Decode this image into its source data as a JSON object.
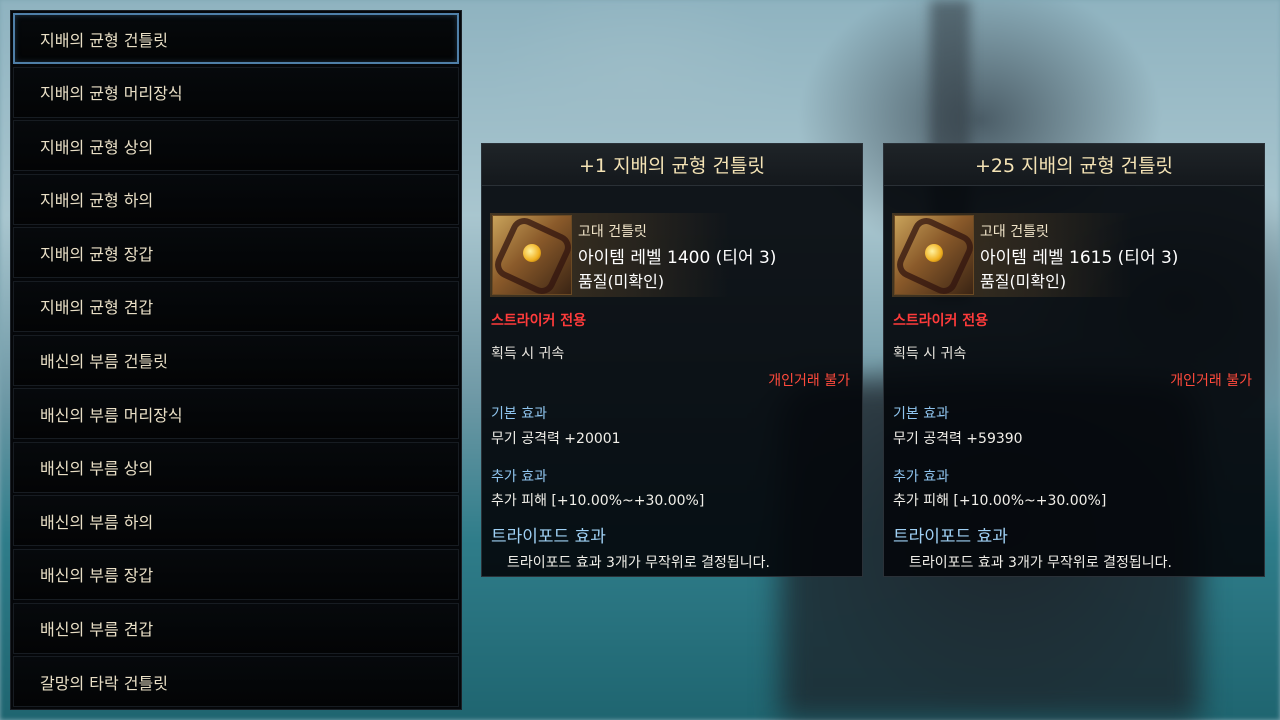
{
  "item_list": [
    "지배의 균형 건틀릿",
    "지배의 균형 머리장식",
    "지배의 균형 상의",
    "지배의 균형 하의",
    "지배의 균형 장갑",
    "지배의 균형 견갑",
    "배신의 부름 건틀릿",
    "배신의 부름 머리장식",
    "배신의 부름 상의",
    "배신의 부름 하의",
    "배신의 부름 장갑",
    "배신의 부름 견갑",
    "갈망의 타락 건틀릿"
  ],
  "selected_index": 0,
  "tooltips": [
    {
      "title": "+1 지배의 균형 건틀릿",
      "grade": "고대 건틀릿",
      "item_level": "아이템 레벨 1400 (티어 3)",
      "quality": "품질(미확인)",
      "class_restriction": "스트라이커 전용",
      "bind": "획득 시 귀속",
      "trade": "개인거래 불가",
      "base_effect_label": "기본 효과",
      "base_effect_value": "무기 공격력 +20001",
      "extra_effect_label": "추가 효과",
      "extra_effect_value": "추가 피해 [+10.00%~+30.00%]",
      "tripod_label": "트라이포드 효과",
      "tripod_desc": "트라이포드 효과 3개가 무작위로 결정됩니다."
    },
    {
      "title": "+25 지배의 균형 건틀릿",
      "grade": "고대 건틀릿",
      "item_level": "아이템 레벨 1615 (티어 3)",
      "quality": "품질(미확인)",
      "class_restriction": "스트라이커 전용",
      "bind": "획득 시 귀속",
      "trade": "개인거래 불가",
      "base_effect_label": "기본 효과",
      "base_effect_value": "무기 공격력 +59390",
      "extra_effect_label": "추가 효과",
      "extra_effect_value": "추가 피해 [+10.00%~+30.00%]",
      "tripod_label": "트라이포드 효과",
      "tripod_desc": "트라이포드 효과 3개가 무작위로 결정됩니다."
    }
  ],
  "icons": {
    "item_icon": "gauntlet-icon"
  },
  "colors": {
    "selected_border": "#4f7fa8",
    "class_restriction": "#ff3b3b",
    "trade_restriction": "#ff4a3c",
    "section_label": "#8fc4ee",
    "title": "#f4e3b5"
  }
}
